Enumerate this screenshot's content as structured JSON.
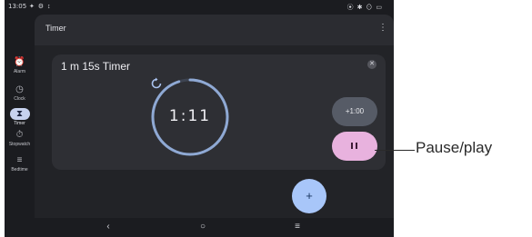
{
  "status_bar": {
    "time": "13:05",
    "left_icons": "✦ ⚙ ↕",
    "right_icons": "⦿ ✱ ⊙ ▭"
  },
  "nav_rail": {
    "items": [
      {
        "label": "Alarm",
        "icon": "alarm-icon",
        "glyph": "⏰",
        "active": false
      },
      {
        "label": "Clock",
        "icon": "clock-icon",
        "glyph": "◷",
        "active": false
      },
      {
        "label": "Timer",
        "icon": "hourglass-icon",
        "glyph": "⧗",
        "active": true
      },
      {
        "label": "Stopwatch",
        "icon": "stopwatch-icon",
        "glyph": "⏱",
        "active": false
      },
      {
        "label": "Bedtime",
        "icon": "bed-icon",
        "glyph": "≡",
        "active": false
      }
    ]
  },
  "app_bar": {
    "title": "Timer",
    "more_glyph": "⋮"
  },
  "timer_card": {
    "name": "1 m 15s Timer",
    "close_glyph": "✕",
    "remaining": "1:11",
    "progress_fraction": 0.95,
    "add_time_label": "+1:00"
  },
  "fab": {
    "glyph": "+"
  },
  "system_nav": {
    "back_glyph": "‹",
    "home_glyph": "○",
    "recents_glyph": "≡"
  },
  "callout": {
    "label": "Pause/play"
  },
  "colors": {
    "background": "#1b1c20",
    "card": "#2e2f34",
    "ring_track": "#3d4350",
    "ring_progress": "#8fa9d4",
    "pause_button": "#e8b2de",
    "fab": "#a8c6f9",
    "add_time_button": "#565b66"
  }
}
